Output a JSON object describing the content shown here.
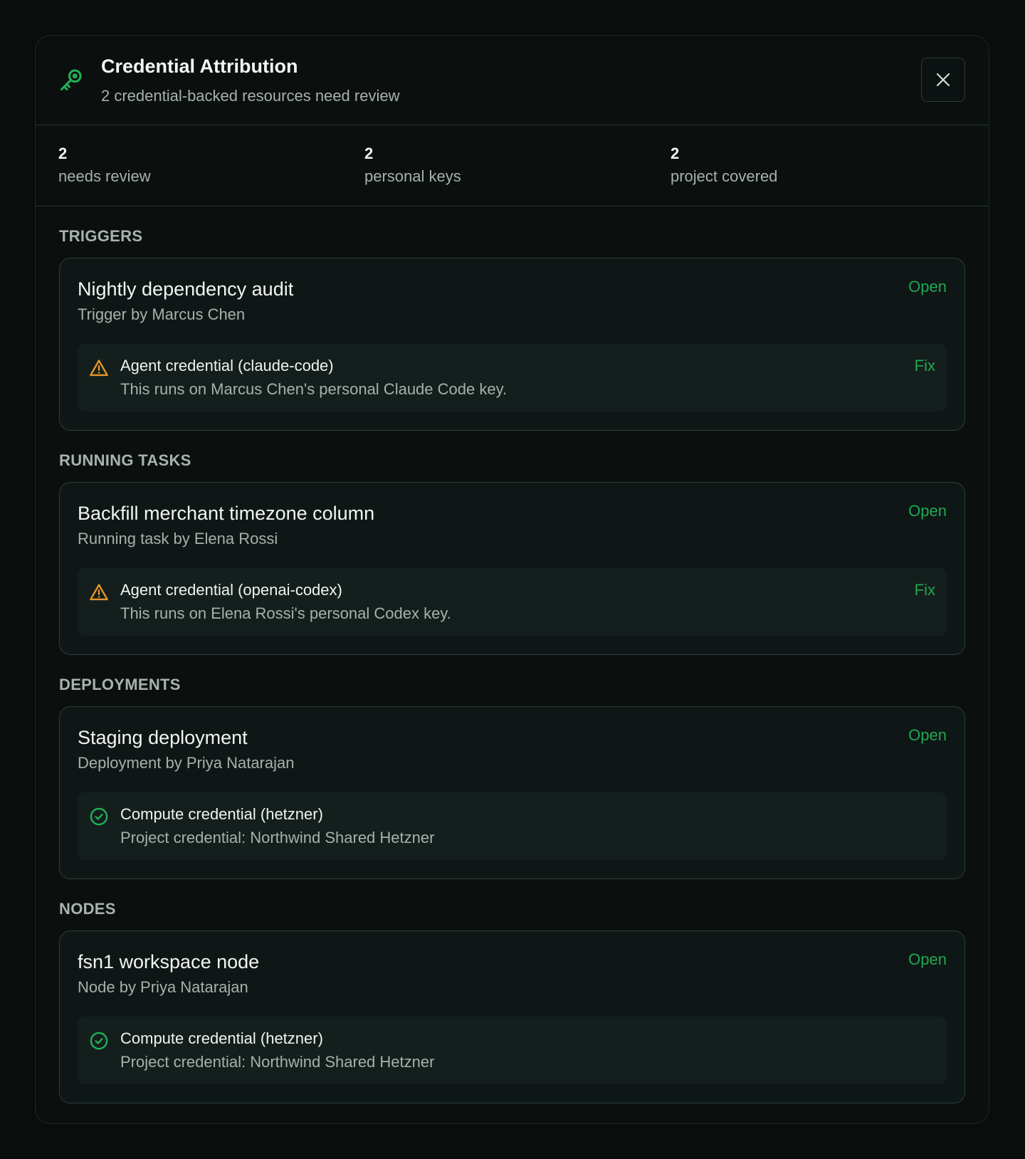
{
  "header": {
    "title": "Credential Attribution",
    "subtitle": "2 credential-backed resources need review",
    "icon": "key-icon",
    "close_icon": "close-icon"
  },
  "stats": [
    {
      "value": "2",
      "label": "needs review"
    },
    {
      "value": "2",
      "label": "personal keys"
    },
    {
      "value": "2",
      "label": "project covered"
    }
  ],
  "sections": [
    {
      "title": "TRIGGERS",
      "card": {
        "title": "Nightly dependency audit",
        "subtitle": "Trigger by Marcus Chen",
        "open_label": "Open",
        "credential": {
          "status": "warning",
          "icon": "warning-icon",
          "title": "Agent credential (claude-code)",
          "description": "This runs on Marcus Chen's personal Claude Code key.",
          "fix_label": "Fix"
        }
      }
    },
    {
      "title": "RUNNING TASKS",
      "card": {
        "title": "Backfill merchant timezone column",
        "subtitle": "Running task by Elena Rossi",
        "open_label": "Open",
        "credential": {
          "status": "warning",
          "icon": "warning-icon",
          "title": "Agent credential (openai-codex)",
          "description": "This runs on Elena Rossi's personal Codex key.",
          "fix_label": "Fix"
        }
      }
    },
    {
      "title": "DEPLOYMENTS",
      "card": {
        "title": "Staging deployment",
        "subtitle": "Deployment by Priya Natarajan",
        "open_label": "Open",
        "credential": {
          "status": "ok",
          "icon": "check-circle-icon",
          "title": "Compute credential (hetzner)",
          "description": "Project credential: Northwind Shared Hetzner",
          "fix_label": ""
        }
      }
    },
    {
      "title": "NODES",
      "card": {
        "title": "fsn1 workspace node",
        "subtitle": "Node by Priya Natarajan",
        "open_label": "Open",
        "credential": {
          "status": "ok",
          "icon": "check-circle-icon",
          "title": "Compute credential (hetzner)",
          "description": "Project credential: Northwind Shared Hetzner",
          "fix_label": ""
        }
      }
    }
  ],
  "colors": {
    "accent": "#1fa852",
    "warning": "#e7962a",
    "background": "#090d0c",
    "card": "#0f1716"
  }
}
